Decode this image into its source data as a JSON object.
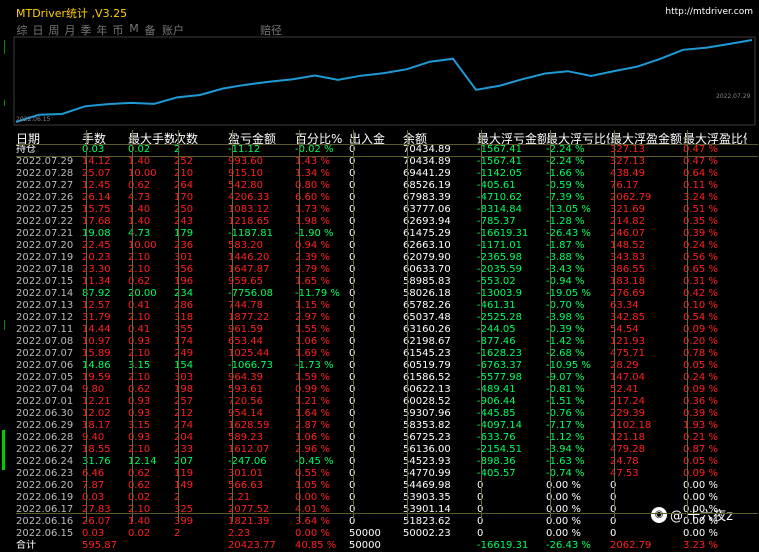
{
  "window": {
    "title": "MTDriver统计 ,V3.25",
    "url": "http://mtdriver.com"
  },
  "tabs": [
    "综",
    "日",
    "周",
    "月",
    "季",
    "年",
    "币",
    "M",
    "备",
    "账户",
    "赔径"
  ],
  "chart": {
    "start_date": "2022.06.15",
    "end_date": "2022.07.29",
    "line_color": "#1e9ad6",
    "balance_series": [
      50002,
      51823,
      52002,
      53903,
      54469,
      54770,
      54523,
      56136,
      56725,
      58353,
      59307,
      60028,
      60622,
      61586,
      60519,
      61545,
      62198,
      63160,
      65037,
      65782,
      58026,
      58985,
      60633,
      62079,
      62663,
      61475,
      62693,
      63777,
      65723,
      67983,
      68526,
      69441,
      70434
    ]
  },
  "table": {
    "headers": [
      "日期",
      "手数",
      "最大手数",
      "次数",
      "盈亏金额",
      "百分比%",
      "出入金",
      "余额",
      "最大浮亏金额",
      "最大浮亏比例",
      "最大浮盈金额",
      "最大浮盈比例"
    ],
    "summary_top": {
      "date": "持仓",
      "lots": "0.03",
      "max_lots": "0.02",
      "count": "2",
      "pnl": "-11.12",
      "pct": "-0.02 %",
      "flow": "0",
      "balance": "70434.89",
      "max_loss": "-1567.41",
      "max_loss_pct": "-2.24 %",
      "max_gain": "327.13",
      "max_gain_pct": "0.47 %"
    },
    "rows": [
      [
        "2022.07.29",
        "14.12",
        "1.40",
        "252",
        "993.60",
        "1.43 %",
        "0",
        "70434.89",
        "-1567.41",
        "-2.24 %",
        "327.13",
        "0.47 %",
        "r"
      ],
      [
        "2022.07.28",
        "25.07",
        "10.00",
        "210",
        "915.10",
        "1.34 %",
        "0",
        "69441.29",
        "-1142.05",
        "-1.66 %",
        "438.49",
        "0.64 %",
        "r"
      ],
      [
        "2022.07.27",
        "12.45",
        "0.62",
        "264",
        "542.80",
        "0.80 %",
        "0",
        "68526.19",
        "-405.61",
        "-0.59 %",
        "76.17",
        "0.11 %",
        "r"
      ],
      [
        "2022.07.26",
        "26.14",
        "4.73",
        "170",
        "4206.33",
        "6.60 %",
        "0",
        "67983.39",
        "-4710.62",
        "-7.39 %",
        "2062.79",
        "3.24 %",
        "r"
      ],
      [
        "2022.07.25",
        "15.75",
        "1.40",
        "250",
        "1083.12",
        "1.73 %",
        "0",
        "63777.06",
        "-8314.84",
        "-13.05 %",
        "321.69",
        "0.51 %",
        "r"
      ],
      [
        "2022.07.22",
        "17.68",
        "1.40",
        "243",
        "1218.65",
        "1.98 %",
        "0",
        "62693.94",
        "-785.37",
        "-1.28 %",
        "214.82",
        "0.35 %",
        "r"
      ],
      [
        "2022.07.21",
        "19.08",
        "4.73",
        "179",
        "-1187.81",
        "-1.90 %",
        "0",
        "61475.29",
        "-16619.31",
        "-26.43 %",
        "246.07",
        "0.39 %",
        "g"
      ],
      [
        "2022.07.20",
        "22.45",
        "10.00",
        "236",
        "583.20",
        "0.94 %",
        "0",
        "62663.10",
        "-1171.01",
        "-1.87 %",
        "148.52",
        "0.24 %",
        "r"
      ],
      [
        "2022.07.19",
        "20.23",
        "2.10",
        "301",
        "1446.20",
        "2.39 %",
        "0",
        "62079.90",
        "-2365.98",
        "-3.88 %",
        "343.83",
        "0.56 %",
        "r"
      ],
      [
        "2022.07.18",
        "23.30",
        "2.10",
        "356",
        "1647.87",
        "2.79 %",
        "0",
        "60633.70",
        "-2035.59",
        "-3.43 %",
        "386.55",
        "0.65 %",
        "r"
      ],
      [
        "2022.07.15",
        "11.34",
        "0.62",
        "196",
        "959.65",
        "1.65 %",
        "0",
        "58985.83",
        "-553.02",
        "-0.94 %",
        "183.18",
        "0.31 %",
        "r"
      ],
      [
        "2022.07.14",
        "87.92",
        "20.00",
        "234",
        "-7756.08",
        "-11.79 %",
        "0",
        "58026.18",
        "-13003.9",
        "-19.05 %",
        "276.69",
        "0.42 %",
        "g"
      ],
      [
        "2022.07.13",
        "12.57",
        "0.41",
        "286",
        "744.78",
        "1.15 %",
        "0",
        "65782.26",
        "-461.31",
        "-0.70 %",
        "63.34",
        "0.10 %",
        "r"
      ],
      [
        "2022.07.12",
        "31.79",
        "2.10",
        "318",
        "1877.22",
        "2.97 %",
        "0",
        "65037.48",
        "-2525.28",
        "-3.98 %",
        "342.85",
        "0.54 %",
        "r"
      ],
      [
        "2022.07.11",
        "14.44",
        "0.41",
        "355",
        "961.59",
        "1.55 %",
        "0",
        "63160.26",
        "-244.05",
        "-0.39 %",
        "54.54",
        "0.09 %",
        "r"
      ],
      [
        "2022.07.08",
        "10.97",
        "0.93",
        "174",
        "653.44",
        "1.06 %",
        "0",
        "62198.67",
        "-877.46",
        "-1.42 %",
        "121.93",
        "0.20 %",
        "r"
      ],
      [
        "2022.07.07",
        "15.89",
        "2.10",
        "249",
        "1025.44",
        "1.69 %",
        "0",
        "61545.23",
        "-1628.23",
        "-2.68 %",
        "475.71",
        "0.78 %",
        "r"
      ],
      [
        "2022.07.06",
        "14.86",
        "3.15",
        "154",
        "-1066.73",
        "-1.73 %",
        "0",
        "60519.79",
        "-6763.37",
        "-10.95 %",
        "28.29",
        "0.05 %",
        "g"
      ],
      [
        "2022.07.05",
        "19.59",
        "2.10",
        "303",
        "964.39",
        "1.59 %",
        "0",
        "61586.52",
        "-5577.98",
        "-9.07 %",
        "147.04",
        "0.24 %",
        "r"
      ],
      [
        "2022.07.04",
        "9.80",
        "0.62",
        "198",
        "593.61",
        "0.99 %",
        "0",
        "60622.13",
        "-489.41",
        "-0.81 %",
        "52.41",
        "0.09 %",
        "r"
      ],
      [
        "2022.07.01",
        "12.21",
        "0.93",
        "257",
        "720.56",
        "1.21 %",
        "0",
        "60028.52",
        "-906.44",
        "-1.51 %",
        "217.24",
        "0.36 %",
        "r"
      ],
      [
        "2022.06.30",
        "12.02",
        "0.93",
        "212",
        "954.14",
        "1.64 %",
        "0",
        "59307.96",
        "-445.85",
        "-0.76 %",
        "229.39",
        "0.39 %",
        "r"
      ],
      [
        "2022.06.29",
        "18.17",
        "3.15",
        "274",
        "1628.59",
        "2.87 %",
        "0",
        "58353.82",
        "-4097.14",
        "-7.17 %",
        "1102.18",
        "1.93 %",
        "r"
      ],
      [
        "2022.06.28",
        "9.40",
        "0.93",
        "204",
        "589.23",
        "1.06 %",
        "0",
        "56725.23",
        "-633.76",
        "-1.12 %",
        "121.18",
        "0.21 %",
        "r"
      ],
      [
        "2022.06.27",
        "18.55",
        "2.10",
        "233",
        "1612.07",
        "2.96 %",
        "0",
        "56136.00",
        "-2154.51",
        "-3.94 %",
        "479.28",
        "0.87 %",
        "r"
      ],
      [
        "2022.06.24",
        "31.76",
        "12.14",
        "207",
        "-247.06",
        "-0.45 %",
        "0",
        "54523.93",
        "-898.36",
        "-1.63 %",
        "24.78",
        "0.05 %",
        "g"
      ],
      [
        "2022.06.23",
        "6.46",
        "0.62",
        "119",
        "301.01",
        "0.55 %",
        "0",
        "54770.99",
        "-405.57",
        "-0.74 %",
        "47.53",
        "0.09 %",
        "r"
      ],
      [
        "2022.06.20",
        "7.87",
        "0.62",
        "149",
        "566.63",
        "1.05 %",
        "0",
        "54469.98",
        "0",
        "0.00 %",
        "0",
        "0.00 %",
        "r"
      ],
      [
        "2022.06.19",
        "0.03",
        "0.02",
        "2",
        "2.21",
        "0.00 %",
        "0",
        "53903.35",
        "0",
        "0.00 %",
        "0",
        "0.00 %",
        "r"
      ],
      [
        "2022.06.17",
        "27.83",
        "2.10",
        "325",
        "2077.52",
        "4.01 %",
        "0",
        "53901.14",
        "0",
        "0.00 %",
        "0",
        "0.00 %",
        "r"
      ],
      [
        "2022.06.16",
        "26.07",
        "1.40",
        "399",
        "1821.39",
        "3.64 %",
        "0",
        "51823.62",
        "0",
        "0.00 %",
        "0",
        "0.00 %",
        "r"
      ],
      [
        "2022.06.15",
        "0.03",
        "0.02",
        "2",
        "2.23",
        "0.00 %",
        "50000",
        "50002.23",
        "0",
        "0.00 %",
        "0",
        "0.00 %",
        "r"
      ]
    ],
    "summary_bottom": {
      "date": "合计",
      "lots": "595.87",
      "max_lots": "",
      "count": "",
      "pnl": "20423.77",
      "pct": "40.85 %",
      "flow": "50000",
      "balance": "",
      "max_loss": "-16619.31",
      "max_loss_pct": "-26.43 %",
      "max_gain": "2062.79",
      "max_gain_pct": "3.23 %"
    }
  },
  "watermark": {
    "text": "@ 十六夜z",
    "icon": "weibo-icon"
  }
}
